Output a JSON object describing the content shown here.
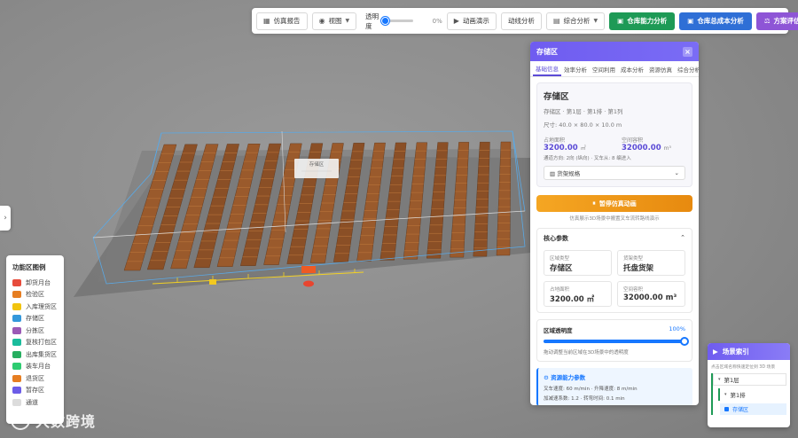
{
  "toolbar": {
    "sim_report": "仿真报告",
    "view": "视图",
    "opacity_label": "透明度",
    "opacity_value": "0%",
    "opacity_fraction": 0.0,
    "animation": "动画演示",
    "flow": "动线分析",
    "composite": "综合分析",
    "capacity": "仓库能力分析",
    "cost": "仓库总成本分析",
    "evaluate": "方案评估"
  },
  "scene": {
    "zone_label": "存储区"
  },
  "legend": {
    "title": "功能区图例",
    "items": [
      {
        "label": "卸货月台",
        "color": "#e74c3c"
      },
      {
        "label": "检验区",
        "color": "#e67e22"
      },
      {
        "label": "入库理货区",
        "color": "#f1c40f"
      },
      {
        "label": "存储区",
        "color": "#3498db"
      },
      {
        "label": "分拣区",
        "color": "#9b59b6"
      },
      {
        "label": "复核打包区",
        "color": "#1abc9c"
      },
      {
        "label": "出库集货区",
        "color": "#27ae60"
      },
      {
        "label": "装车月台",
        "color": "#2ecc71"
      },
      {
        "label": "退货区",
        "color": "#e67e22"
      },
      {
        "label": "暂存区",
        "color": "#6c5ce7"
      },
      {
        "label": "通道",
        "color": "#dcdcdc"
      }
    ]
  },
  "watermark": "大数跨境",
  "panel": {
    "title": "存储区",
    "tabs": [
      "基础信息",
      "效率分析",
      "空间利用",
      "成本分析",
      "资源仿真",
      "综合分析"
    ],
    "card": {
      "name": "存储区",
      "location": "存储区 · 第1层 · 第1排 · 第1列",
      "size": "尺寸: 40.0 × 80.0 × 10.0 m",
      "area_label": "占地面积",
      "area_value": "3200.00",
      "area_unit": "㎡",
      "volume_label": "空间容积",
      "volume_value": "32000.00",
      "volume_unit": "m³",
      "note": "通道方向: 2向 (纵向) · 叉车从: 8 编进入",
      "select": "货架规格"
    },
    "anim_button": "暂停仿真动画",
    "anim_hint": "仿真展示3D场景中搬置叉车流转路线演示",
    "core": {
      "title": "核心参数",
      "cells": [
        {
          "label": "区域类型",
          "value": "存储区"
        },
        {
          "label": "货架类型",
          "value": "托盘货架"
        },
        {
          "label": "占地面积",
          "value": "3200.00 ㎡"
        },
        {
          "label": "空间容积",
          "value": "32000.00 m³"
        }
      ]
    },
    "opacity": {
      "title": "区域透明度",
      "value": "100%",
      "fraction": 1.0,
      "hint": "拖动调整当前区域在3D场景中的透明度"
    },
    "info": {
      "title": "资源能力参数",
      "line1": "叉车速度: 60 m/min · 升降速度: 8 m/min",
      "line2": "加减速系数: 1.2 · 转弯时间: 0.1 min"
    }
  },
  "index": {
    "title": "场景索引",
    "hint": "点击区域名称快速定位到 3D 场景",
    "level1": "第1层",
    "level2": "第1排",
    "level3": "存储区"
  }
}
